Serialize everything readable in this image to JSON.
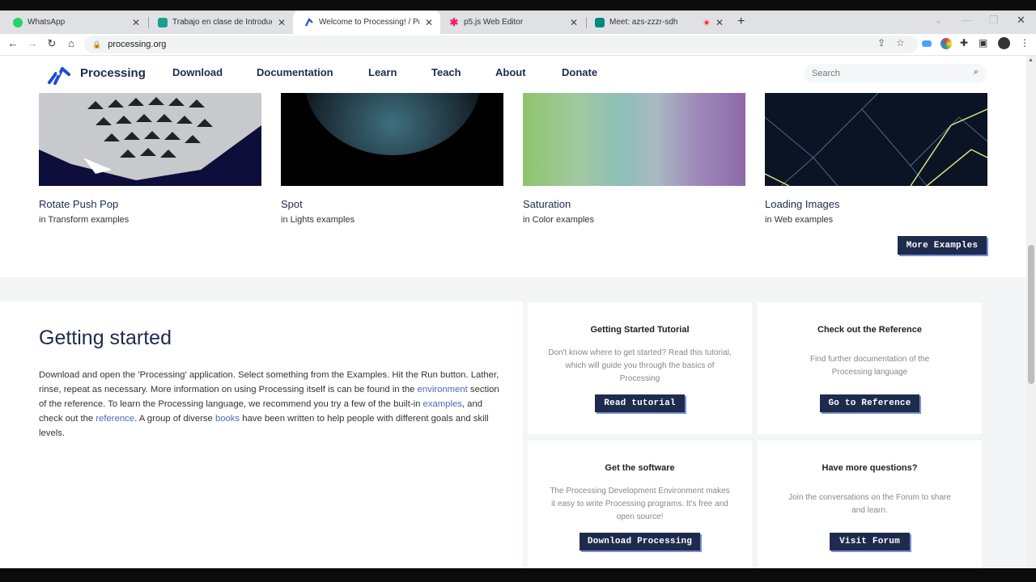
{
  "browser": {
    "tabs": [
      {
        "title": "WhatsApp",
        "icon": "whatsapp-icon"
      },
      {
        "title": "Trabajo en clase de Introducción",
        "icon": "classroom-icon"
      },
      {
        "title": "Welcome to Processing! / Proces",
        "icon": "processing-icon"
      },
      {
        "title": "p5.js Web Editor",
        "icon": "p5js-icon"
      },
      {
        "title": "Meet: azs-zzzr-sdh",
        "icon": "meet-icon"
      }
    ],
    "url": "processing.org"
  },
  "site": {
    "brand": "Processing",
    "nav": [
      "Download",
      "Documentation",
      "Learn",
      "Teach",
      "About",
      "Donate"
    ],
    "search_placeholder": "Search"
  },
  "examples": {
    "items": [
      {
        "title": "Rotate Push Pop",
        "prefix": "in",
        "category": "Transform examples"
      },
      {
        "title": "Spot",
        "prefix": "in",
        "category": "Lights examples"
      },
      {
        "title": "Saturation",
        "prefix": "in",
        "category": "Color examples"
      },
      {
        "title": "Loading Images",
        "prefix": "in",
        "category": "Web examples"
      }
    ],
    "more_label": "More Examples"
  },
  "getting_started": {
    "title": "Getting started",
    "para": {
      "t1": "Download and open the 'Processing' application. Select something from the Examples. Hit the Run button. Lather, rinse, repeat as necessary. More information on using Processing itself is can be found in the ",
      "l1": "environment",
      "t2": " section of the reference. To learn the Processing language, we recommend you try a few of the built-in ",
      "l2": "examples",
      "t3": ", and check out the ",
      "l3": "reference",
      "t4": ". A group of diverse ",
      "l4": "books",
      "t5": " have been written to help people with different goals and skill levels."
    },
    "cards": [
      {
        "title": "Getting Started Tutorial",
        "desc": "Don't know where to get started? Read this tutorial, which will guide you through the basics of Processing",
        "button": "Read tutorial"
      },
      {
        "title": "Check out the Reference",
        "desc": "Find further documentation of the Processing language",
        "button": "Go to Reference"
      },
      {
        "title": "Get the software",
        "desc": "The Processing Development Environment makes it easy to write Processing programs. It's free and open source!",
        "button": "Download Processing"
      },
      {
        "title": "Have more questions?",
        "desc": "Join the conversations on the Forum to share and learn.",
        "button": "Visit Forum"
      }
    ]
  },
  "colors": {
    "brand_navy": "#1e2b4d",
    "link_blue": "#4a6ab8",
    "button_shadow": "#7b8fd6"
  }
}
